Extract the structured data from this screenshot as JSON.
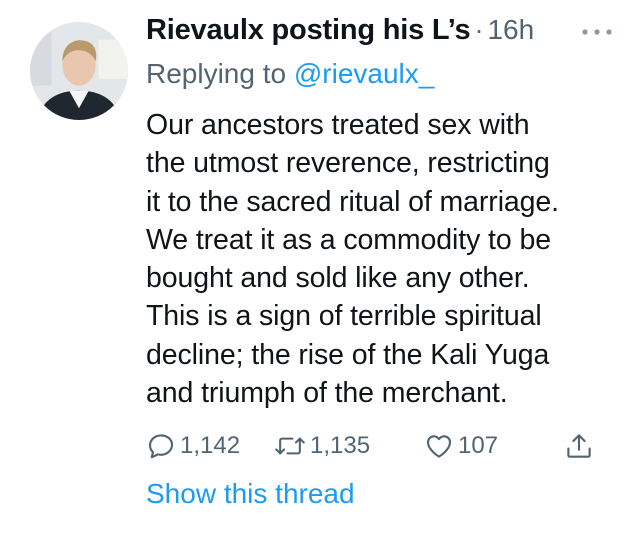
{
  "tweet": {
    "author_name": "Rievaulx posting his L’s",
    "separator": "·",
    "timestamp": "16h",
    "replying_prefix": "Replying to ",
    "replying_handle": "@rievaulx_",
    "text_lines": [
      "Our ancestors treated sex with",
      "the utmost reverence, restricting",
      "it to the sacred ritual of marriage.",
      "We treat it as a commodity to be",
      "bought and sold like any other.",
      "This is a sign of terrible spiritual",
      "decline; the rise of the Kali Yuga",
      "and triumph of the merchant."
    ],
    "actions": {
      "reply": {
        "icon": "reply-icon",
        "count": "1,142"
      },
      "retweet": {
        "icon": "retweet-icon",
        "count": "1,135"
      },
      "like": {
        "icon": "heart-icon",
        "count": "107"
      },
      "share": {
        "icon": "share-icon"
      }
    },
    "show_thread_label": "Show this thread"
  },
  "colors": {
    "text": "#0f1419",
    "secondary": "#536471",
    "link": "#1d9bf0",
    "background": "#ffffff"
  }
}
